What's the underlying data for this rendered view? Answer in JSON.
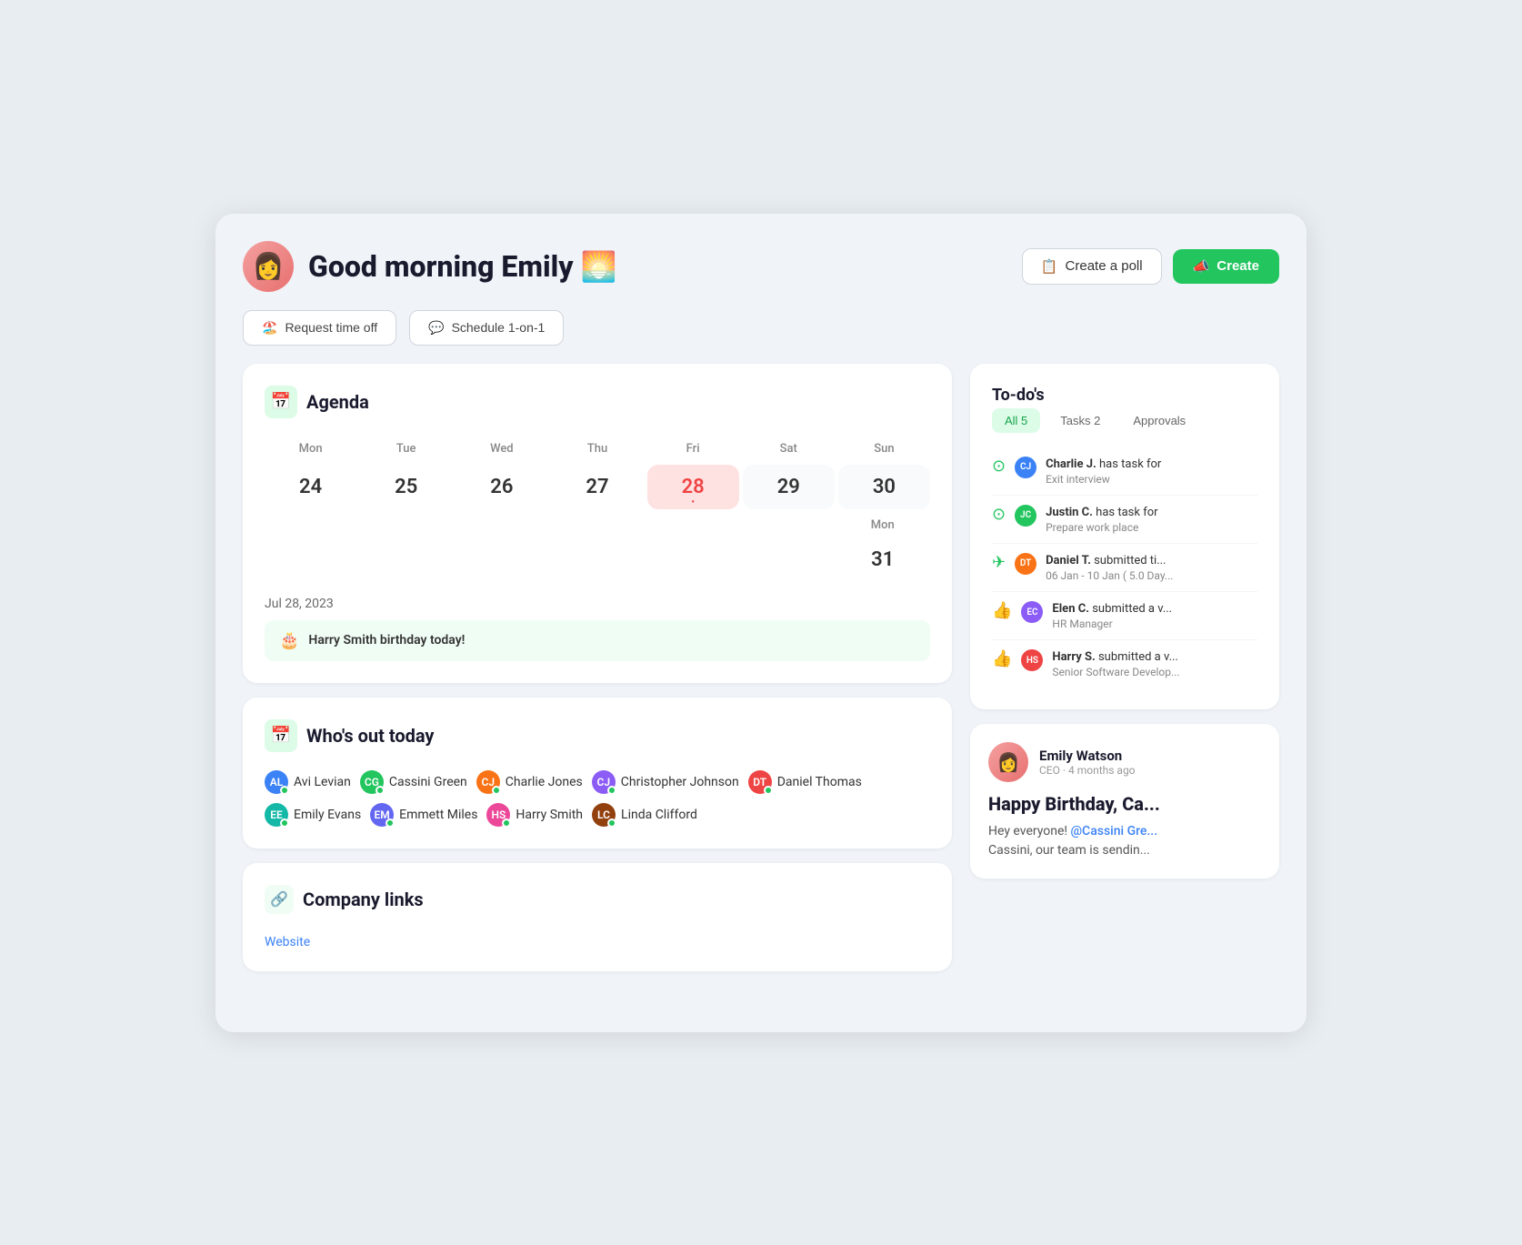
{
  "header": {
    "greeting": "Good morning Emily 🌅",
    "emoji": "🌅",
    "create_poll_label": "Create a poll",
    "create_label": "Create",
    "avatar_emoji": "👩"
  },
  "action_buttons": {
    "request_time_off": "Request time off",
    "schedule_1on1": "Schedule 1-on-1"
  },
  "agenda": {
    "title": "Agenda",
    "days": [
      {
        "name": "Mon",
        "num": "24",
        "weekend": false,
        "today": false
      },
      {
        "name": "Tue",
        "num": "25",
        "weekend": false,
        "today": false
      },
      {
        "name": "Wed",
        "num": "26",
        "weekend": false,
        "today": false
      },
      {
        "name": "Thu",
        "num": "27",
        "weekend": false,
        "today": false
      },
      {
        "name": "Fri",
        "num": "28",
        "weekend": false,
        "today": true
      },
      {
        "name": "Sat",
        "num": "29",
        "weekend": true,
        "today": false
      },
      {
        "name": "Sun",
        "num": "30",
        "weekend": true,
        "today": false
      },
      {
        "name": "Mon",
        "num": "31",
        "weekend": false,
        "today": false
      }
    ],
    "date_label": "Jul 28, 2023",
    "event_text": "Harry Smith birthday today!"
  },
  "whos_out": {
    "title": "Who's out today",
    "people": [
      {
        "name": "Avi Levian",
        "color": "av-blue"
      },
      {
        "name": "Cassini Green",
        "color": "av-green"
      },
      {
        "name": "Charlie Jones",
        "color": "av-orange"
      },
      {
        "name": "Christopher Johnson",
        "color": "av-purple"
      },
      {
        "name": "Daniel Thomas",
        "color": "av-red"
      },
      {
        "name": "Emily Evans",
        "color": "av-teal"
      },
      {
        "name": "Emmett Miles",
        "color": "av-indigo"
      },
      {
        "name": "Harry Smith",
        "color": "av-pink"
      },
      {
        "name": "Linda Clifford",
        "color": "av-brown"
      }
    ]
  },
  "company_links": {
    "title": "Company links",
    "links": [
      {
        "label": "Website"
      }
    ]
  },
  "todos": {
    "title": "To-do's",
    "tabs": [
      {
        "label": "All 5",
        "active": true
      },
      {
        "label": "Tasks 2",
        "active": false
      },
      {
        "label": "Approvals",
        "active": false
      }
    ],
    "items": [
      {
        "icon": "✅",
        "icon_type": "check",
        "person_name": "Charlie J.",
        "action": "has task for",
        "detail": "Exit interview",
        "color": "av-blue"
      },
      {
        "icon": "✅",
        "icon_type": "check",
        "person_name": "Justin C.",
        "action": "has task for",
        "detail": "Prepare work place",
        "color": "av-green"
      },
      {
        "icon": "✈️",
        "icon_type": "plane",
        "person_name": "Daniel T.",
        "action": "submitted ti...",
        "detail": "06 Jan - 10 Jan ( 5.0 Day...",
        "color": "av-orange"
      },
      {
        "icon": "👍",
        "icon_type": "thumbs",
        "person_name": "Elen C.",
        "action": "submitted a v...",
        "detail": "HR Manager",
        "color": "av-purple"
      },
      {
        "icon": "👍",
        "icon_type": "thumbs",
        "person_name": "Harry S.",
        "action": "submitted a v...",
        "detail": "Senior Software Develop...",
        "color": "av-red"
      }
    ]
  },
  "post": {
    "author_name": "Emily Watson",
    "author_role": "CEO",
    "time_ago": "4 months ago",
    "title": "Happy Birthday, Ca...",
    "body_line1": "Hey everyone!",
    "mention": "@Cassini Gre...",
    "body_line2": "Cassini, our team is sendin..."
  }
}
